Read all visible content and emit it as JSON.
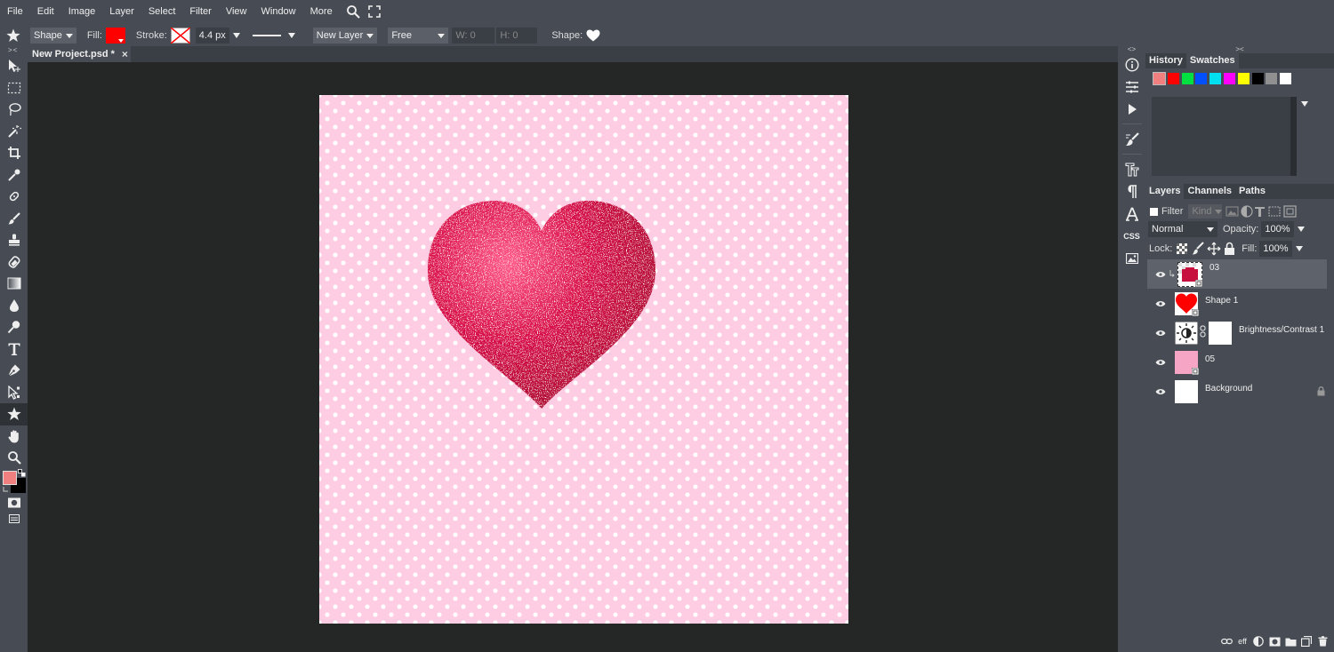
{
  "menubar": {
    "items": [
      "File",
      "Edit",
      "Image",
      "Layer",
      "Select",
      "Filter",
      "View",
      "Window",
      "More"
    ]
  },
  "options": {
    "tool_mode": "Shape",
    "fill_label": "Fill:",
    "fill_color": "#ff0000",
    "stroke_label": "Stroke:",
    "stroke_width": "4.4 px",
    "layer_mode": "New Layer",
    "constraint": "Free",
    "w_label": "W:",
    "w_value": "0",
    "h_label": "H:",
    "h_value": "0",
    "shape_label": "Shape:"
  },
  "document": {
    "tab_title": "New Project.psd *",
    "close_glyph": "×"
  },
  "colors": {
    "foreground": "#f08080",
    "background": "#000000",
    "canvas_bg": "#ffcde3"
  },
  "history_panel": {
    "tabs": [
      "History",
      "Swatches"
    ],
    "swatches": [
      "#f08080",
      "#ff0000",
      "#00e040",
      "#0050ff",
      "#00e0f0",
      "#ff00ff",
      "#ffff00",
      "#000000",
      "#909090",
      "#ffffff"
    ]
  },
  "layers_panel": {
    "tabs": [
      "Layers",
      "Channels",
      "Paths"
    ],
    "filter_label": "Filter",
    "kind_placeholder": "Kind",
    "blend_mode": "Normal",
    "opacity_label": "Opacity:",
    "opacity_value": "100%",
    "lock_label": "Lock:",
    "fill_label": "Fill:",
    "fill_value": "100%",
    "layers": [
      {
        "name": "03"
      },
      {
        "name": "Shape 1"
      },
      {
        "name": "Brightness/Contrast 1"
      },
      {
        "name": "05"
      },
      {
        "name": "Background"
      }
    ],
    "bottom_eff": "eff"
  },
  "strip": {
    "css_label": "CSS"
  }
}
